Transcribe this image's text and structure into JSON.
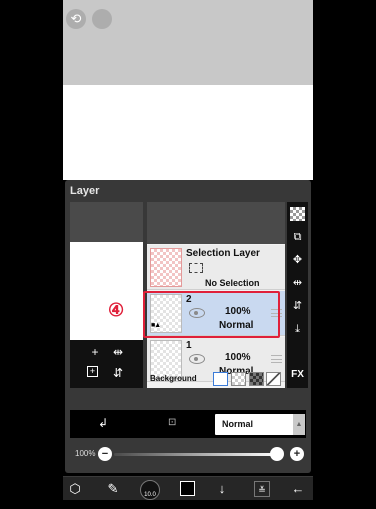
{
  "top_bar": {
    "undo_icon": "undo-icon",
    "redo_icon": "redo-icon"
  },
  "layer_panel": {
    "title": "Layer",
    "layers": [
      {
        "name": "Selection Layer",
        "value": "No Selection"
      },
      {
        "name": "2",
        "opacity": "100%",
        "blend": "Normal",
        "selected": true
      },
      {
        "name": "1",
        "opacity": "100%",
        "blend": "Normal"
      }
    ],
    "background_label": "Background",
    "step_marker": "④"
  },
  "blend_mode": {
    "value": "Normal"
  },
  "opacity": {
    "value_label": "100%",
    "level": 1.0
  },
  "bottom_toolbar": {
    "brush_size_label": "10.0"
  },
  "colors": {
    "highlight": "#e0203a",
    "selected_row": "#c9d9f0",
    "panel_bg": "#383838"
  }
}
